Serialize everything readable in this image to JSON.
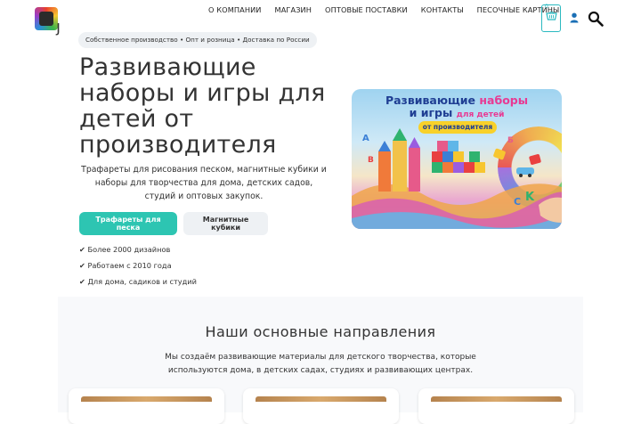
{
  "header": {
    "nav": [
      "О КОМПАНИИ",
      "МАГАЗИН",
      "ОПТОВЫЕ ПОСТАВКИ",
      "КОНТАКТЫ",
      "ПЕСОЧНЫЕ КАРТИНЫ"
    ],
    "cart_count": "0"
  },
  "hero": {
    "tagline": "Собственное производство • Опт и розница • Доставка по России",
    "title": "Развивающие наборы и игры для детей от производителя",
    "description": "Трафареты для рисования песком, магнитные кубики и наборы для творчества для дома, детских садов, студий и оптовых закупок.",
    "primary_button": "Трафареты для песка",
    "secondary_button": "Магнитные кубики",
    "features": [
      "✔ Более 2000 дизайнов",
      "✔ Работаем с 2010 года",
      "✔ Для дома, садиков и студий"
    ],
    "image": {
      "title_line1_a": "Развивающие ",
      "title_line1_b": "наборы",
      "title_line2_a": "и игры ",
      "title_line2_b": "для детей",
      "badge": "от производителя"
    }
  },
  "directions": {
    "title": "Наши основные направления",
    "description": "Мы создаём развивающие материалы для детского творчества, которые используются дома, в детских садах, студиях и развивающих центрах."
  },
  "colors": {
    "accent": "#2dc5b2",
    "cart_border": "#2bb9c0",
    "image_title": "#1f3e93",
    "image_highlight": "#e83a93"
  }
}
